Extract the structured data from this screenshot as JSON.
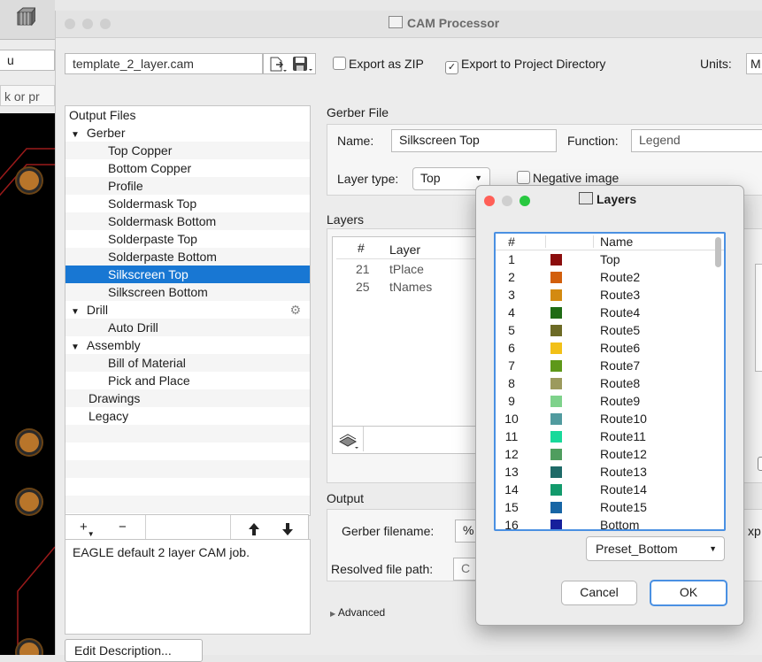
{
  "window": {
    "title": "CAM Processor"
  },
  "background": {
    "left_input_text": "u",
    "left_input2_text": "k or pr"
  },
  "top": {
    "job_file": "template_2_layer.cam",
    "export_zip_label": "Export as ZIP",
    "export_zip_checked": false,
    "export_project_label": "Export to Project Directory",
    "export_project_checked": true,
    "units_label": "Units:",
    "units_value": "M"
  },
  "output_files": {
    "header": "Output Files",
    "items": [
      {
        "label": "Gerber",
        "level": 0,
        "expander": "▼"
      },
      {
        "label": "Top Copper",
        "level": 2
      },
      {
        "label": "Bottom Copper",
        "level": 2
      },
      {
        "label": "Profile",
        "level": 2
      },
      {
        "label": "Soldermask Top",
        "level": 2
      },
      {
        "label": "Soldermask Bottom",
        "level": 2
      },
      {
        "label": "Solderpaste Top",
        "level": 2
      },
      {
        "label": "Solderpaste Bottom",
        "level": 2
      },
      {
        "label": "Silkscreen Top",
        "level": 2,
        "selected": true
      },
      {
        "label": "Silkscreen Bottom",
        "level": 2
      },
      {
        "label": "Drill",
        "level": 0,
        "expander": "▼",
        "gear": true
      },
      {
        "label": "Auto Drill",
        "level": 2
      },
      {
        "label": "Assembly",
        "level": 0,
        "expander": "▼"
      },
      {
        "label": "Bill of Material",
        "level": 2
      },
      {
        "label": "Pick and Place",
        "level": 2
      },
      {
        "label": "Drawings",
        "level": 1
      },
      {
        "label": "Legacy",
        "level": 1
      },
      {
        "label": ""
      },
      {
        "label": ""
      },
      {
        "label": ""
      },
      {
        "label": ""
      },
      {
        "label": ""
      }
    ],
    "toolbar": {
      "add": "+",
      "remove": "−",
      "up": "🡑",
      "down": "🡓"
    },
    "description": "EAGLE default 2 layer CAM job.",
    "edit_description": "Edit Description..."
  },
  "gerber": {
    "section": "Gerber File",
    "name_label": "Name:",
    "name_value": "Silkscreen Top",
    "function_label": "Function:",
    "function_value": "Legend",
    "layer_type_label": "Layer type:",
    "layer_type_value": "Top",
    "negative_label": "Negative image",
    "layers_section": "Layers",
    "layers_header": {
      "num": "#",
      "layer": "Layer"
    },
    "layers": [
      {
        "num": "21",
        "name": "tPlace"
      },
      {
        "num": "25",
        "name": "tNames"
      }
    ]
  },
  "output": {
    "section": "Output",
    "gerber_filename_label": "Gerber filename:",
    "gerber_filename_value": "%",
    "gerber_suffix_partial": "xp",
    "resolved_label": "Resolved file path:",
    "resolved_value": "C",
    "advanced": "Advanced"
  },
  "layers_dialog": {
    "title": "Layers",
    "col_num": "#",
    "col_name": "Name",
    "rows": [
      {
        "num": "1",
        "name": "Top",
        "color": "#8b0d0d"
      },
      {
        "num": "2",
        "name": "Route2",
        "color": "#d25f0c"
      },
      {
        "num": "3",
        "name": "Route3",
        "color": "#d38a10"
      },
      {
        "num": "4",
        "name": "Route4",
        "color": "#1f6b14"
      },
      {
        "num": "5",
        "name": "Route5",
        "color": "#6c6a25"
      },
      {
        "num": "6",
        "name": "Route6",
        "color": "#f2c017"
      },
      {
        "num": "7",
        "name": "Route7",
        "color": "#5e9819"
      },
      {
        "num": "8",
        "name": "Route8",
        "color": "#9c9a5d"
      },
      {
        "num": "9",
        "name": "Route9",
        "color": "#7ed28b"
      },
      {
        "num": "10",
        "name": "Route10",
        "color": "#519b9f"
      },
      {
        "num": "11",
        "name": "Route11",
        "color": "#18d99a"
      },
      {
        "num": "12",
        "name": "Route12",
        "color": "#4f9d5e"
      },
      {
        "num": "13",
        "name": "Route13",
        "color": "#1e6a68"
      },
      {
        "num": "14",
        "name": "Route14",
        "color": "#129a6c"
      },
      {
        "num": "15",
        "name": "Route15",
        "color": "#1765a5"
      },
      {
        "num": "16",
        "name": "Bottom",
        "color": "#161f9c"
      }
    ],
    "preset_value": "Preset_Bottom",
    "cancel": "Cancel",
    "ok": "OK"
  }
}
